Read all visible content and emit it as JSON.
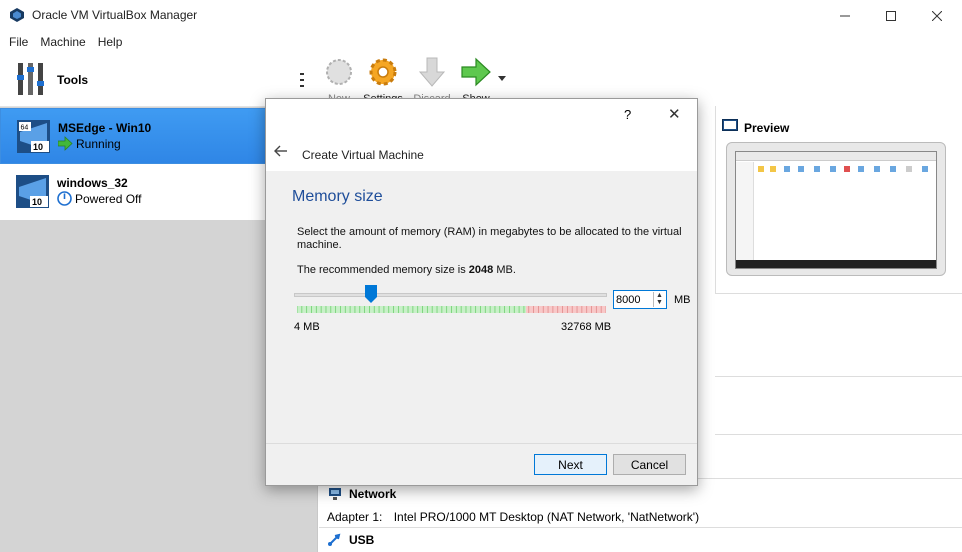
{
  "window": {
    "title": "Oracle VM VirtualBox Manager"
  },
  "menu": [
    "File",
    "Machine",
    "Help"
  ],
  "sidebar": {
    "tools_label": "Tools",
    "vms": [
      {
        "name": "MSEdge - Win10",
        "status": "Running",
        "os_badge": "10",
        "selected": true
      },
      {
        "name": "windows_32",
        "status": "Powered Off",
        "os_badge": "10",
        "selected": false
      }
    ]
  },
  "toolbar": {
    "new_label": "New",
    "settings_label": "Settings",
    "discard_label": "Discard",
    "show_label": "Show"
  },
  "details": {
    "preview_title": "Preview",
    "network": {
      "title": "Network",
      "adapter_label": "Adapter 1:",
      "adapter_value": "Intel PRO/1000 MT Desktop (NAT Network, 'NatNetwork')"
    },
    "usb": {
      "title": "USB"
    }
  },
  "dialog": {
    "help": "?",
    "close": "✕",
    "title": "Create Virtual Machine",
    "heading": "Memory size",
    "description": "Select the amount of memory (RAM) in megabytes to be allocated to the virtual machine.",
    "recommended_prefix": "The recommended memory size is ",
    "recommended_value": "2048",
    "recommended_suffix": " MB.",
    "memory": {
      "min": 4,
      "max": 32768,
      "value": 8000,
      "unit": "MB"
    },
    "min_label": "4 MB",
    "max_label": "32768 MB",
    "spin_value": "8000",
    "unit_label": "MB",
    "next_label": "Next",
    "cancel_label": "Cancel"
  },
  "colors": {
    "accent": "#0078d7",
    "heading": "#1f4e9a",
    "selected_vm": "#3f9bf2"
  }
}
